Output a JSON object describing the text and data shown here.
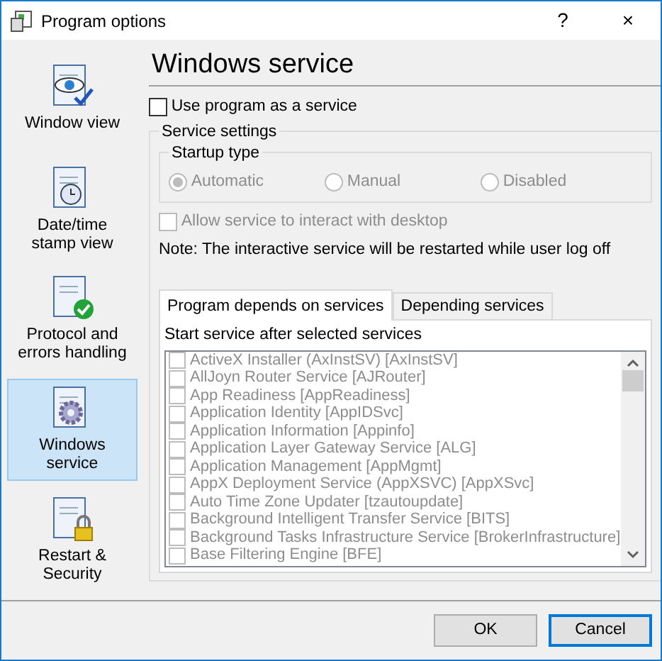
{
  "window": {
    "title": "Program options",
    "help": "?",
    "close": "×"
  },
  "sidebar": {
    "items": [
      {
        "label": "Window view",
        "selected": false
      },
      {
        "label": "Date/time stamp view",
        "selected": false
      },
      {
        "label": "Protocol and errors handling",
        "selected": false
      },
      {
        "label": "Windows service",
        "selected": true
      },
      {
        "label": "Restart & Security",
        "selected": false
      }
    ]
  },
  "heading": "Windows service",
  "use_service": {
    "label": "Use program as a service",
    "checked": false
  },
  "service_settings": {
    "title": "Service settings",
    "disabled": true,
    "startup_type": {
      "title": "Startup type",
      "options": [
        {
          "label": "Automatic",
          "selected": true
        },
        {
          "label": "Manual",
          "selected": false
        },
        {
          "label": "Disabled",
          "selected": false
        }
      ]
    },
    "interact": {
      "label": "Allow service to interact with desktop",
      "checked": false
    },
    "note": "Note: The interactive service will be restarted while user log off",
    "tabs": [
      {
        "label": "Program depends on services",
        "selected": true
      },
      {
        "label": "Depending services",
        "selected": false
      }
    ],
    "list_caption": "Start service after selected services",
    "services": [
      {
        "label": "ActiveX Installer (AxInstSV) [AxInstSV]",
        "checked": false
      },
      {
        "label": "AllJoyn Router Service [AJRouter]",
        "checked": false
      },
      {
        "label": "App Readiness [AppReadiness]",
        "checked": false
      },
      {
        "label": "Application Identity [AppIDSvc]",
        "checked": false
      },
      {
        "label": "Application Information [Appinfo]",
        "checked": false
      },
      {
        "label": "Application Layer Gateway Service [ALG]",
        "checked": false
      },
      {
        "label": "Application Management [AppMgmt]",
        "checked": false
      },
      {
        "label": "AppX Deployment Service (AppXSVC) [AppXSvc]",
        "checked": false
      },
      {
        "label": "Auto Time Zone Updater [tzautoupdate]",
        "checked": false
      },
      {
        "label": "Background Intelligent Transfer Service [BITS]",
        "checked": false
      },
      {
        "label": "Background Tasks Infrastructure Service [BrokerInfrastructure]",
        "checked": false
      },
      {
        "label": "Base Filtering Engine [BFE]",
        "checked": false
      }
    ]
  },
  "buttons": [
    {
      "label": "OK",
      "default": false
    },
    {
      "label": "Cancel",
      "default": true
    }
  ]
}
